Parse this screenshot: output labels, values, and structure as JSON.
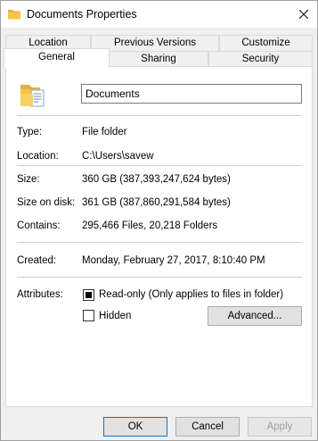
{
  "window": {
    "title": "Documents Properties",
    "title_icon": "folder-icon",
    "close_icon": "close-icon"
  },
  "tabs": {
    "row1": [
      "Location",
      "Previous Versions",
      "Customize"
    ],
    "row2": [
      "General",
      "Sharing",
      "Security"
    ],
    "active": "General"
  },
  "general": {
    "folder_icon": "folder-documents-icon",
    "name_value": "Documents",
    "type_label": "Type:",
    "type_value": "File folder",
    "location_label": "Location:",
    "location_value": "C:\\Users\\savew",
    "size_label": "Size:",
    "size_value": "360 GB (387,393,247,624 bytes)",
    "size_on_disk_label": "Size on disk:",
    "size_on_disk_value": "361 GB (387,860,291,584 bytes)",
    "contains_label": "Contains:",
    "contains_value": "295,466 Files, 20,218 Folders",
    "created_label": "Created:",
    "created_value": "Monday, February 27, 2017, 8:10:40 PM",
    "attributes_label": "Attributes:",
    "readonly_label": "Read-only (Only applies to files in folder)",
    "readonly_state": "indeterminate",
    "hidden_label": "Hidden",
    "hidden_checked": false,
    "advanced_label": "Advanced..."
  },
  "footer": {
    "ok_label": "OK",
    "cancel_label": "Cancel",
    "apply_label": "Apply",
    "apply_enabled": false
  },
  "colors": {
    "accent": "#0078d7",
    "folder": "#f5c542"
  }
}
